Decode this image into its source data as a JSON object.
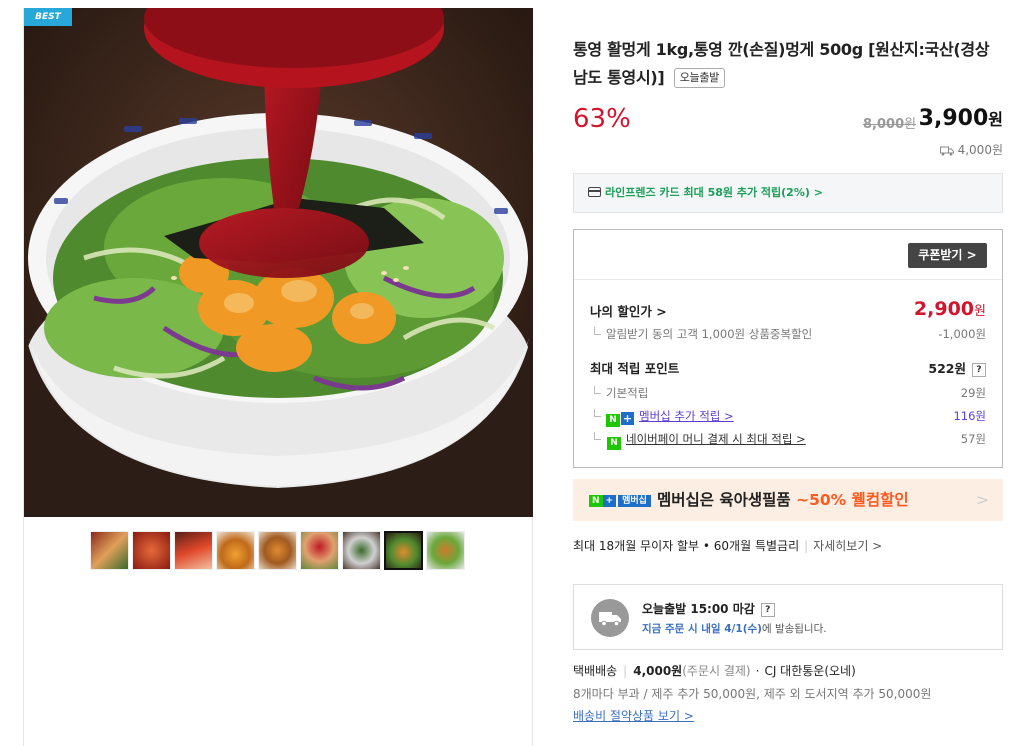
{
  "gallery": {
    "badge": "BEST",
    "thumbnail_count": 9,
    "active_thumbnail": 8
  },
  "product": {
    "title": "통영 활멍게 1kg,통영 깐(손질)멍게 500g [원산지:국산(경상남도 통영시)]",
    "tag": "오늘출발",
    "discount_rate": "63%",
    "original_price": "8,000",
    "original_unit": "원",
    "sale_price": "3,900",
    "sale_unit": "원",
    "shipping_fee": "4,000원"
  },
  "card_benefit": {
    "text": "라인프렌즈 카드 최대 58원 추가 적립(2%) >"
  },
  "benefits": {
    "coupon_button": "쿠폰받기 >",
    "my_discount_label": "나의 할인가 >",
    "my_discount_value": "2,900",
    "my_discount_unit": "원",
    "alert_label": "알림받기 동의 고객 1,000원 상품중복할인",
    "alert_value": "-1,000원",
    "max_points_label": "최대 적립 포인트",
    "max_points_value": "522원",
    "help_mark": "?",
    "basic_label": "기본적립",
    "basic_value": "29원",
    "membership_label": "멤버십 추가 적립 >",
    "membership_value": "116원",
    "npay_label": "네이버페이 머니 결제 시 최대 적립 >",
    "npay_value": "57원"
  },
  "membership_banner": {
    "tag_n": "N",
    "tag_plus": "+",
    "tag_member": "멤버십",
    "text": "멤버십은 육아생필품 ",
    "highlight": "~50% 웰컴할인",
    "chevron": ">"
  },
  "installment": {
    "text": "최대 18개월 무이자 할부 • 60개월 특별금리",
    "more": "자세히보기 >"
  },
  "delivery": {
    "title": "오늘출발 15:00 마감",
    "help": "?",
    "sub_highlight": "지금 주문 시 내일 4/1(수)",
    "sub_rest": "에 발송됩니다."
  },
  "shipping": {
    "method": "택배배송",
    "fee": "4,000원",
    "fee_note": "(주문시 결제)",
    "carrier": "CJ 대한통운(오네)",
    "extra": "8개마다 부과 / 제주 추가 50,000원, 제주 외 도서지역 추가 50,000원",
    "link": "배송비 절약상품 보기 >"
  }
}
